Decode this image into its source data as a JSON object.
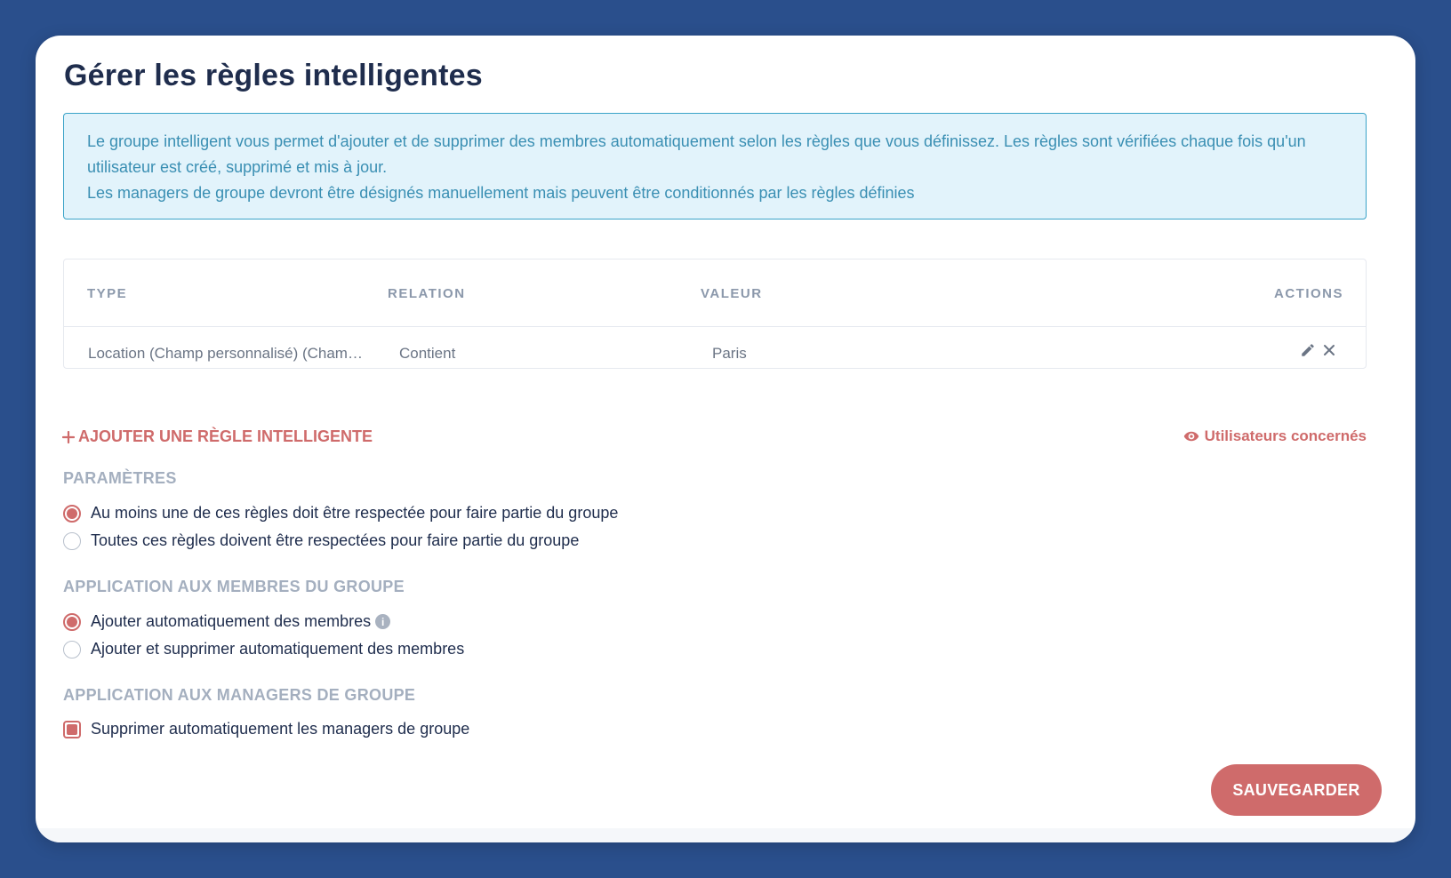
{
  "modal": {
    "title": "Gérer les règles intelligentes",
    "info": {
      "line1": "Le groupe intelligent vous permet d'ajouter et de supprimer des membres automatiquement selon les règles que vous définissez. Les règles sont vérifiées chaque fois qu'un utilisateur est créé, supprimé et mis à jour.",
      "line2": "Les managers de groupe devront être désignés manuellement mais peuvent être conditionnés par les règles définies"
    },
    "table": {
      "headers": {
        "type": "TYPE",
        "relation": "RELATION",
        "value": "VALEUR",
        "actions": "ACTIONS"
      },
      "rows": [
        {
          "type": "Location (Champ personnalisé) (Champ personnalisé)",
          "relation": "Contient",
          "value": "Paris"
        }
      ]
    },
    "add_rule_label": "AJOUTER UNE RÈGLE INTELLIGENTE",
    "users_link_label": "Utilisateurs concernés",
    "settings": {
      "title": "PARAMÈTRES",
      "options": [
        {
          "label": "Au moins une de ces règles doit être respectée pour faire partie du groupe",
          "checked": true
        },
        {
          "label": "Toutes ces règles doivent être respectées pour faire partie du groupe",
          "checked": false
        }
      ]
    },
    "members": {
      "title": "APPLICATION AUX MEMBRES DU GROUPE",
      "options": [
        {
          "label": "Ajouter automatiquement des membres",
          "checked": true
        },
        {
          "label": "Ajouter et supprimer automatiquement des membres",
          "checked": false
        }
      ]
    },
    "managers": {
      "title": "APPLICATION AUX MANAGERS DE GROUPE",
      "checkbox_label": "Supprimer automatiquement les managers de groupe",
      "checked": true
    },
    "save_label": "SAUVEGARDER"
  },
  "colors": {
    "background": "#2a4f8c",
    "accent": "#cf6b6b",
    "info_text": "#3a8fb3",
    "info_bg": "#e2f3fb"
  },
  "icons": [
    "plus-icon",
    "eye-icon",
    "edit-pencil-icon",
    "delete-x-icon",
    "info-icon"
  ]
}
